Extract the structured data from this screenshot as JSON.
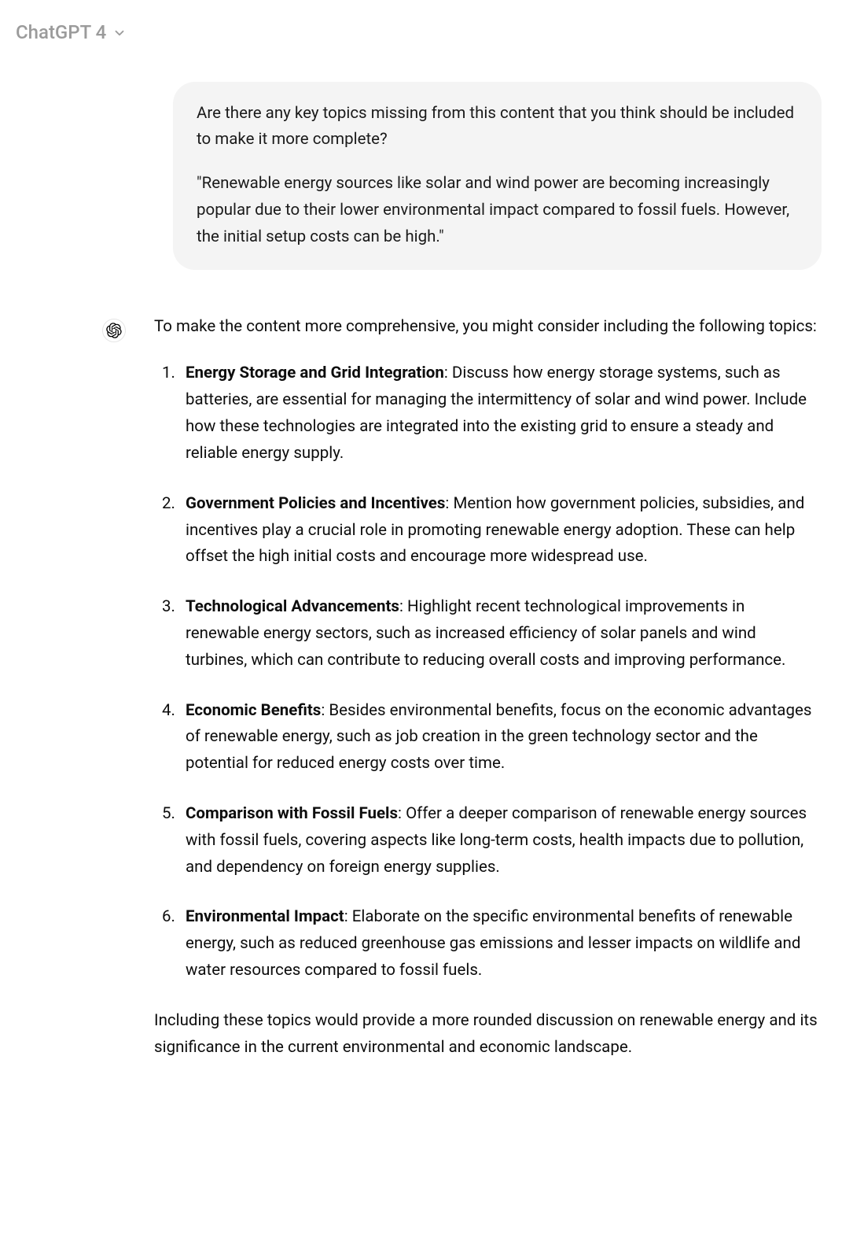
{
  "header": {
    "model_name": "ChatGPT 4"
  },
  "user_message": {
    "paragraph1": "Are there any key topics missing from this content that you think should be included to make it more complete?",
    "paragraph2": "\"Renewable energy sources like solar and wind power are becoming increasingly popular due to their lower environmental impact compared to fossil fuels. However, the initial setup costs can be high.\""
  },
  "assistant_message": {
    "intro": "To make the content more comprehensive, you might consider including the following topics:",
    "items": [
      {
        "title": "Energy Storage and Grid Integration",
        "body": ": Discuss how energy storage systems, such as batteries, are essential for managing the intermittency of solar and wind power. Include how these technologies are integrated into the existing grid to ensure a steady and reliable energy supply."
      },
      {
        "title": "Government Policies and Incentives",
        "body": ": Mention how government policies, subsidies, and incentives play a crucial role in promoting renewable energy adoption. These can help offset the high initial costs and encourage more widespread use."
      },
      {
        "title": "Technological Advancements",
        "body": ": Highlight recent technological improvements in renewable energy sectors, such as increased efficiency of solar panels and wind turbines, which can contribute to reducing overall costs and improving performance."
      },
      {
        "title": "Economic Benefits",
        "body": ": Besides environmental benefits, focus on the economic advantages of renewable energy, such as job creation in the green technology sector and the potential for reduced energy costs over time."
      },
      {
        "title": "Comparison with Fossil Fuels",
        "body": ": Offer a deeper comparison of renewable energy sources with fossil fuels, covering aspects like long-term costs, health impacts due to pollution, and dependency on foreign energy supplies."
      },
      {
        "title": "Environmental Impact",
        "body": ": Elaborate on the specific environmental benefits of renewable energy, such as reduced greenhouse gas emissions and lesser impacts on wildlife and water resources compared to fossil fuels."
      }
    ],
    "outro": "Including these topics would provide a more rounded discussion on renewable energy and its significance in the current environmental and economic landscape."
  }
}
